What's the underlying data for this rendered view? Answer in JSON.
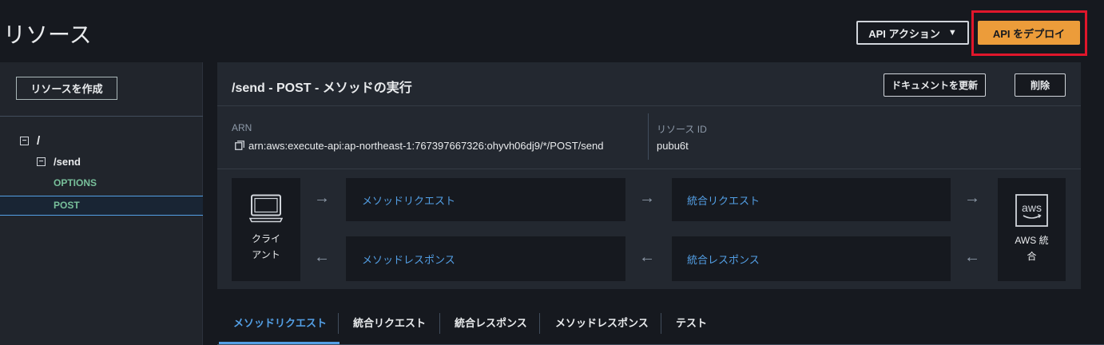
{
  "header": {
    "title": "リソース",
    "actions_label": "API アクション",
    "actions_caret": "▼",
    "deploy_label": "API をデプロイ"
  },
  "sidebar": {
    "create_label": "リソースを作成",
    "tree": {
      "root": "/",
      "send": "/send",
      "options": "OPTIONS",
      "post": "POST",
      "toggle": "−"
    }
  },
  "panel": {
    "title": "/send - POST - メソッドの実行",
    "docs_label": "ドキュメントを更新",
    "delete_label": "削除",
    "arn_label": "ARN",
    "arn_value": "arn:aws:execute-api:ap-northeast-1:767397667326:ohyvh06dj9/*/POST/send",
    "resource_id_label": "リソース ID",
    "resource_id_value": "pubu6t"
  },
  "flow": {
    "client_line1": "クライ",
    "client_line2": "アント",
    "method_request": "メソッドリクエスト",
    "integration_request": "統合リクエスト",
    "method_response": "メソッドレスポンス",
    "integration_response": "統合レスポンス",
    "aws_line1": "AWS 統",
    "aws_line2": "合",
    "aws_logo": "aws",
    "arrow_right": "→",
    "arrow_left": "←"
  },
  "tabs": [
    {
      "label": "メソッドリクエスト"
    },
    {
      "label": "統合リクエスト"
    },
    {
      "label": "統合レスポンス"
    },
    {
      "label": "メソッドレスポンス"
    },
    {
      "label": "テスト"
    }
  ]
}
